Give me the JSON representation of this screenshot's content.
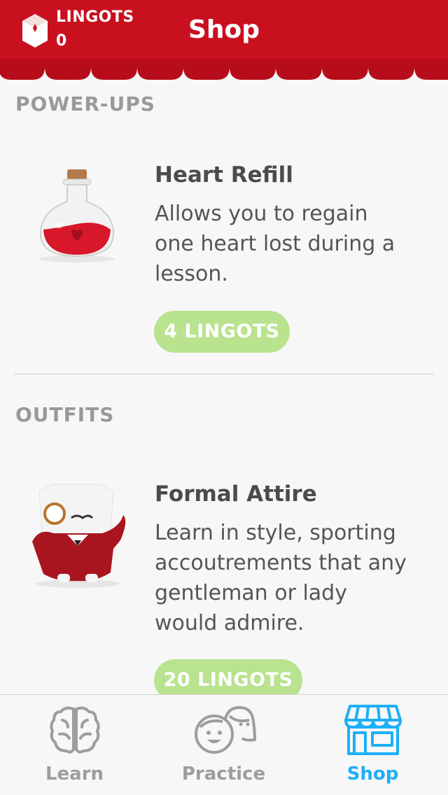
{
  "header": {
    "lingots_label": "LINGOTS",
    "lingots_count": "0",
    "title": "Shop"
  },
  "sections": {
    "powerups": {
      "title": "POWER-UPS",
      "item": {
        "name": "Heart Refill",
        "desc_lines": [
          "Allows you to regain",
          "one heart lost during a",
          "lesson."
        ],
        "price": "4 LINGOTS"
      }
    },
    "outfits": {
      "title": "OUTFITS",
      "item": {
        "name": "Formal Attire",
        "desc_lines": [
          "Learn in style, sporting",
          "accoutrements that any",
          "gentleman or lady",
          "would admire."
        ],
        "price": "20 LINGOTS"
      }
    }
  },
  "tabs": [
    {
      "label": "Learn",
      "icon": "brain-icon"
    },
    {
      "label": "Practice",
      "icon": "faces-icon"
    },
    {
      "label": "Shop",
      "icon": "store-icon"
    }
  ],
  "colors": {
    "header_red": "#c9101f",
    "price_green": "#b9e38f",
    "active_tab": "#1cb0f6",
    "inactive_tab": "#9d9d9d"
  }
}
